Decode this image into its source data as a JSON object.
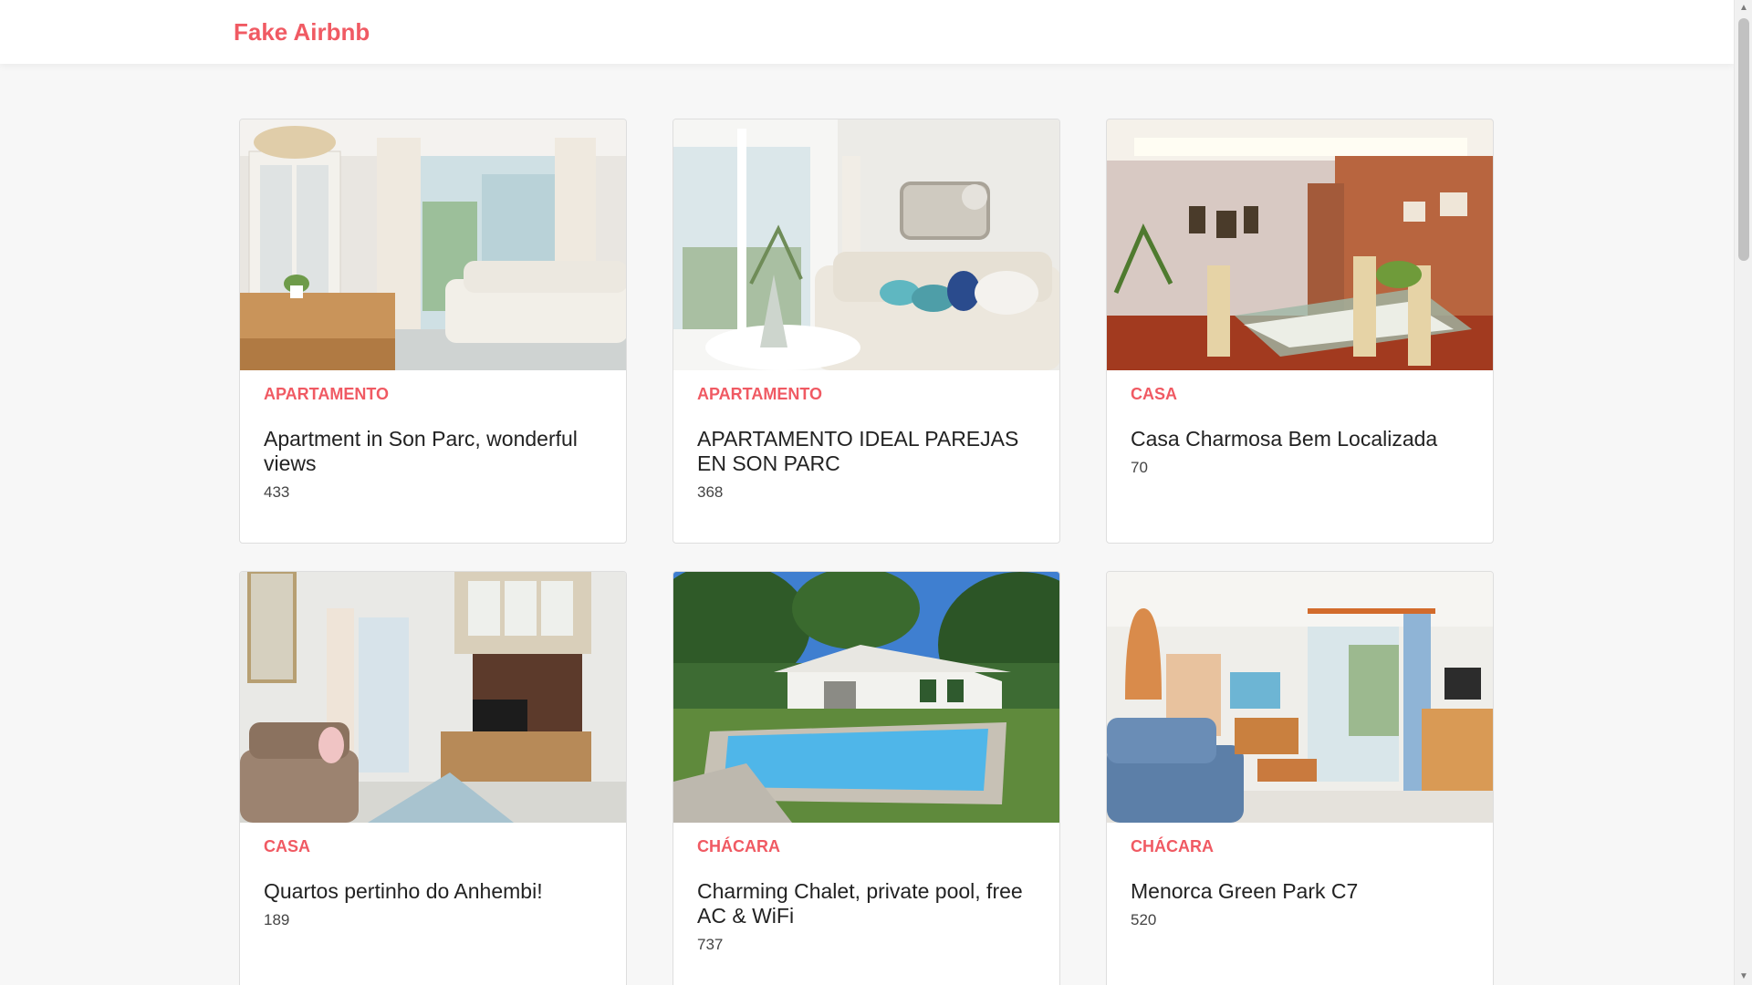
{
  "header": {
    "brand": "Fake Airbnb"
  },
  "listings": [
    {
      "type": "Apartamento",
      "title": "Apartment in Son Parc, wonderful views",
      "price": "433",
      "photo_icon": "living-room-photo"
    },
    {
      "type": "Apartamento",
      "title": "APARTAMENTO IDEAL PAREJAS EN SON PARC",
      "price": "368",
      "photo_icon": "sofa-room-photo"
    },
    {
      "type": "Casa",
      "title": "Casa Charmosa Bem Localizada",
      "price": "70",
      "photo_icon": "dining-room-photo"
    },
    {
      "type": "Casa",
      "title": "Quartos pertinho do Anhembi!",
      "price": "189",
      "photo_icon": "tv-room-photo"
    },
    {
      "type": "Chácara",
      "title": "Charming Chalet, private pool, free AC & WiFi",
      "price": "737",
      "photo_icon": "pool-house-photo"
    },
    {
      "type": "Chácara",
      "title": "Menorca Green Park C7",
      "price": "520",
      "photo_icon": "blue-sofa-room-photo"
    }
  ],
  "colors": {
    "accent": "#f05a63",
    "background": "#f7f7f7",
    "card": "#ffffff"
  }
}
